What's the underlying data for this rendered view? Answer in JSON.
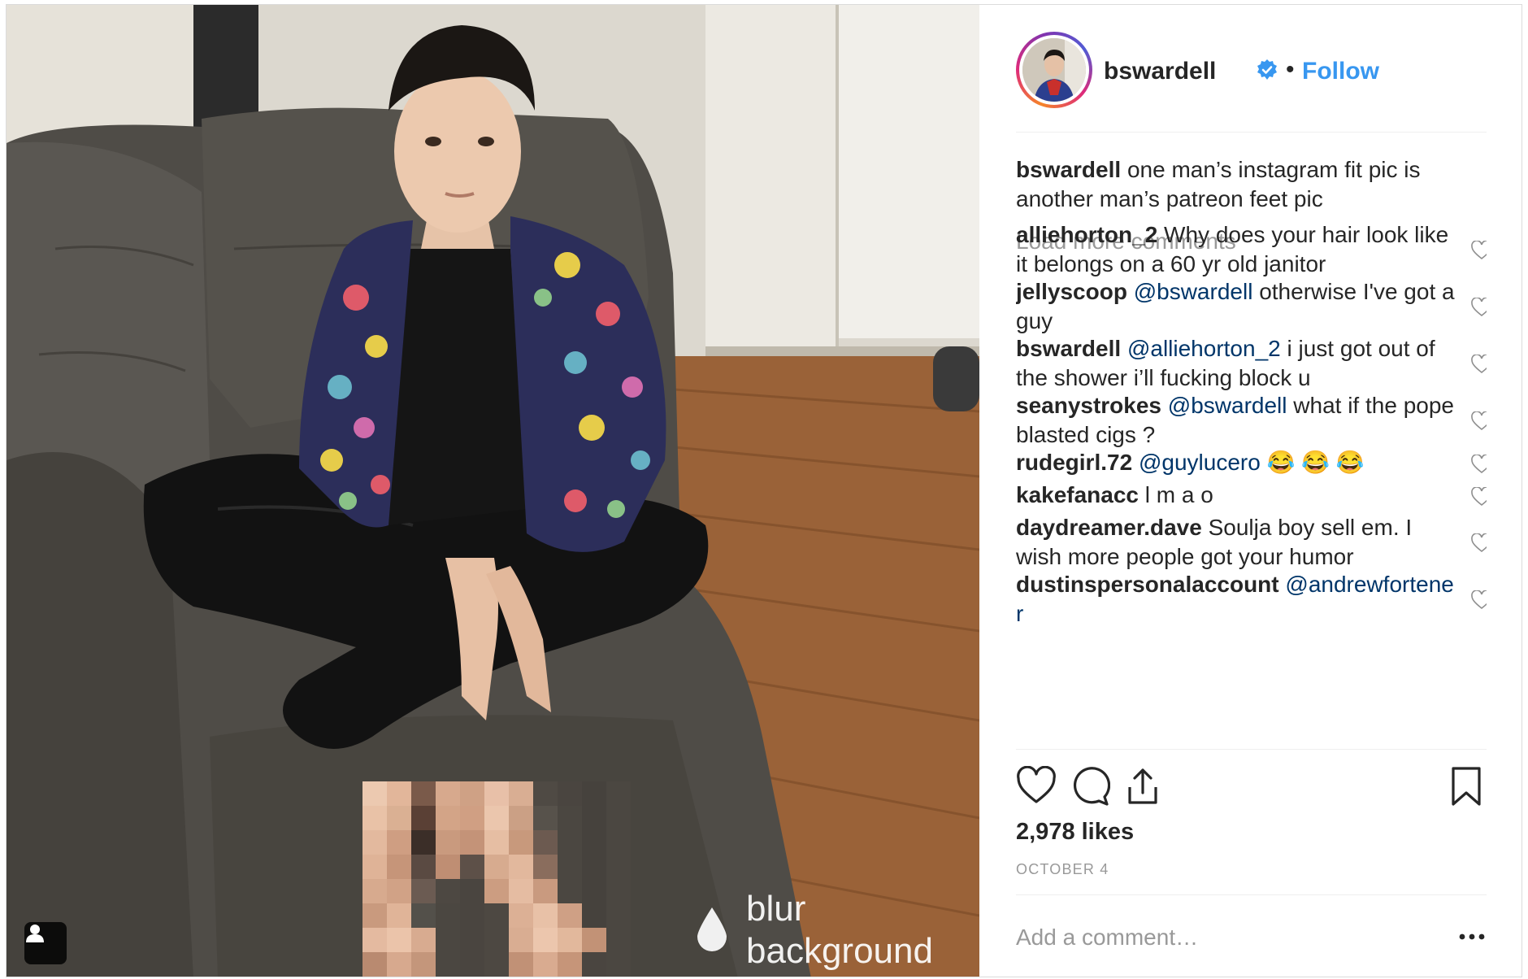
{
  "post": {
    "username": "bswardell",
    "verified": true,
    "follow_label": "Follow",
    "follow_color": "#3897f0"
  },
  "photo": {
    "watermark_line1": "blur",
    "watermark_line2": "background"
  },
  "caption": {
    "username": "bswardell",
    "text": "one man’s instagram fit pic is another man’s patreon feet pic"
  },
  "load_more_label": "Load more comments",
  "comments": [
    {
      "user": "alliehorton_2",
      "mention": "",
      "text": "Why does your hair look like it belongs on a 60 yr old janitor"
    },
    {
      "user": "jellyscoop",
      "mention": "@bswardell",
      "text": "otherwise I've got a guy"
    },
    {
      "user": "bswardell",
      "mention": "@alliehorton_2",
      "text": "i just got out of the shower i’ll fucking block u"
    },
    {
      "user": "seanystrokes",
      "mention": "@bswardell",
      "text": "what if the pope blasted cigs ?"
    },
    {
      "user": "rudegirl.72",
      "mention": "@guylucero",
      "text": "😂 😂 😂"
    },
    {
      "user": "kakefanacc",
      "mention": "",
      "text": "l m a o"
    },
    {
      "user": "daydreamer.dave",
      "mention": "",
      "text": "Soulja boy sell em. I wish more people got your humor"
    },
    {
      "user": "dustinspersonalaccount",
      "mention": "@andrewfortener",
      "text": ""
    }
  ],
  "likes_label": "2,978 likes",
  "date_label": "OCTOBER 4",
  "add_comment_placeholder": "Add a comment…",
  "colors": {
    "text": "#262626",
    "muted": "#999999",
    "mention": "#003569",
    "link": "#3897f0",
    "divider": "#efefef"
  },
  "icons": {
    "like": "heart-icon",
    "comment": "comment-bubble-icon",
    "share": "share-upload-icon",
    "save": "bookmark-icon",
    "more": "ellipsis-icon",
    "verified": "verified-badge-icon",
    "user_tag": "user-tag-icon"
  }
}
